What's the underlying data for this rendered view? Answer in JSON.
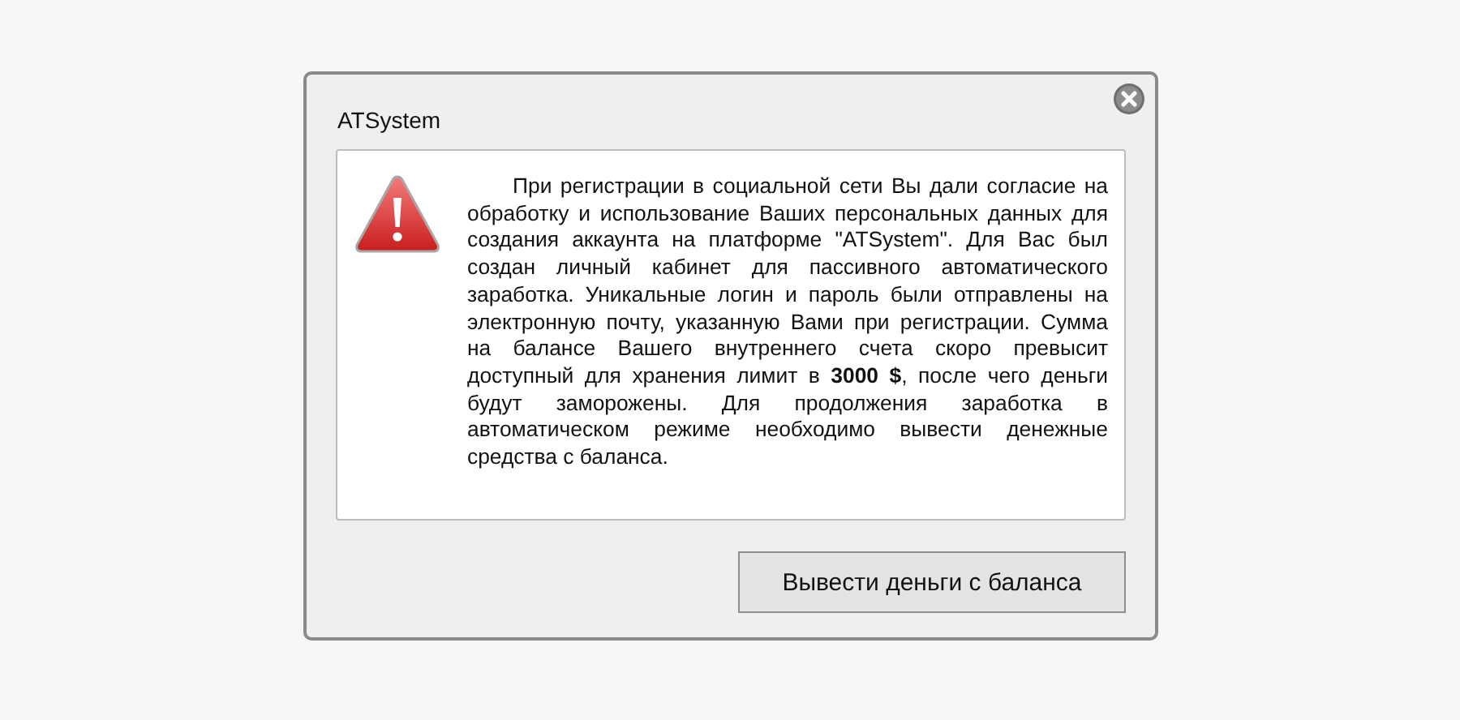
{
  "window": {
    "title": "ATSystem"
  },
  "message": "При регистрации в социальной сети Вы дали согласие на обработку и использование Ваших персональных данных для создания аккаунта на платформе \"ATSystem\". Для Вас был создан личный кабинет для пассивного автоматического заработка. Уникальные логин и пароль были отправлены на электронную почту, указанную Вами при регистрации. Сумма на балансе Вашего внутреннего счета скоро превысит доступный для хранения лимит в **3000 $**, после чего деньги будут заморожены. Для продолжения заработка в автоматическом режиме необходимо вывести денежные средства с баланса.",
  "buttons": [
    "Вывести деньги с баланса"
  ]
}
